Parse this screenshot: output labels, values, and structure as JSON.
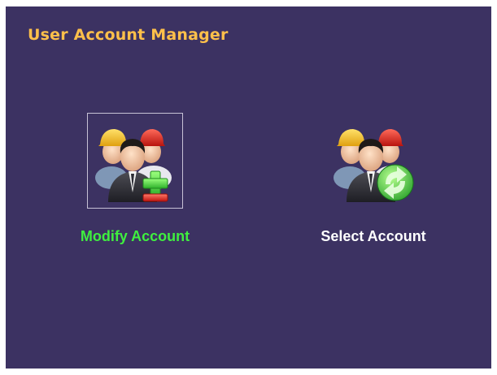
{
  "window": {
    "title": "User Account Manager"
  },
  "tiles": [
    {
      "id": "modify",
      "label": "Modify Account",
      "icon": "users-add-remove-icon",
      "selected": true,
      "label_color": "#3fef3f"
    },
    {
      "id": "select",
      "label": "Select Account",
      "icon": "users-refresh-icon",
      "selected": false,
      "label_color": "#ffffff"
    }
  ],
  "colors": {
    "background": "#3c3262",
    "title": "#ffc04a",
    "selected_label": "#3fef3f",
    "label": "#ffffff"
  }
}
